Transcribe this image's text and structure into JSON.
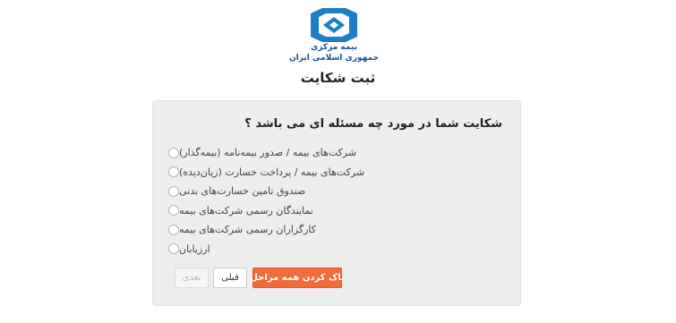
{
  "logo": {
    "line1": "بیمه مرکزی",
    "line2": "جمهوری اسلامی ایران",
    "color": "#1a7fc7"
  },
  "page_title": "ثبت شکایت",
  "form": {
    "question": "شکایت شما در مورد چه مسئله ای می باشد ؟",
    "options": [
      {
        "label": "شرکت‌های بیمه / صدور بیمه‌نامه (بیمه‌گذار)",
        "selected": false
      },
      {
        "label": "شرکت‌های بیمه / پرداخت خسارت (زیان‌دیده)",
        "selected": false
      },
      {
        "label": "صندوق تامین خسارت‌های بدنی",
        "selected": false
      },
      {
        "label": "نمایندگان رسمی شرکت‌های بیمه",
        "selected": false
      },
      {
        "label": "کارگزاران رسمی شرکت‌های بیمه",
        "selected": false
      },
      {
        "label": "ارزیابان",
        "selected": false
      }
    ]
  },
  "buttons": {
    "next_label": "بعدی",
    "prev_label": "قبلی",
    "clear_label": "پاک کردن همه مراحل",
    "accent": "#f26b3a"
  }
}
